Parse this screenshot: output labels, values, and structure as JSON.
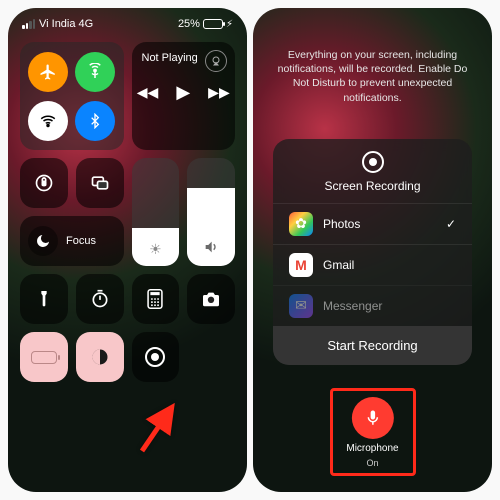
{
  "left": {
    "status": {
      "carrier": "Vi India 4G",
      "battery_pct": "25%"
    },
    "media": {
      "title": "Not Playing"
    },
    "focus": {
      "label": "Focus"
    }
  },
  "right": {
    "notice": "Everything on your screen, including notifications, will be recorded. Enable Do Not Disturb to prevent unexpected notifications.",
    "sheet": {
      "title": "Screen Recording",
      "apps": [
        {
          "name": "Photos",
          "selected": true
        },
        {
          "name": "Gmail",
          "selected": false
        },
        {
          "name": "Messenger",
          "selected": false
        }
      ],
      "start": "Start Recording"
    },
    "mic": {
      "label": "Microphone",
      "state": "On"
    }
  }
}
